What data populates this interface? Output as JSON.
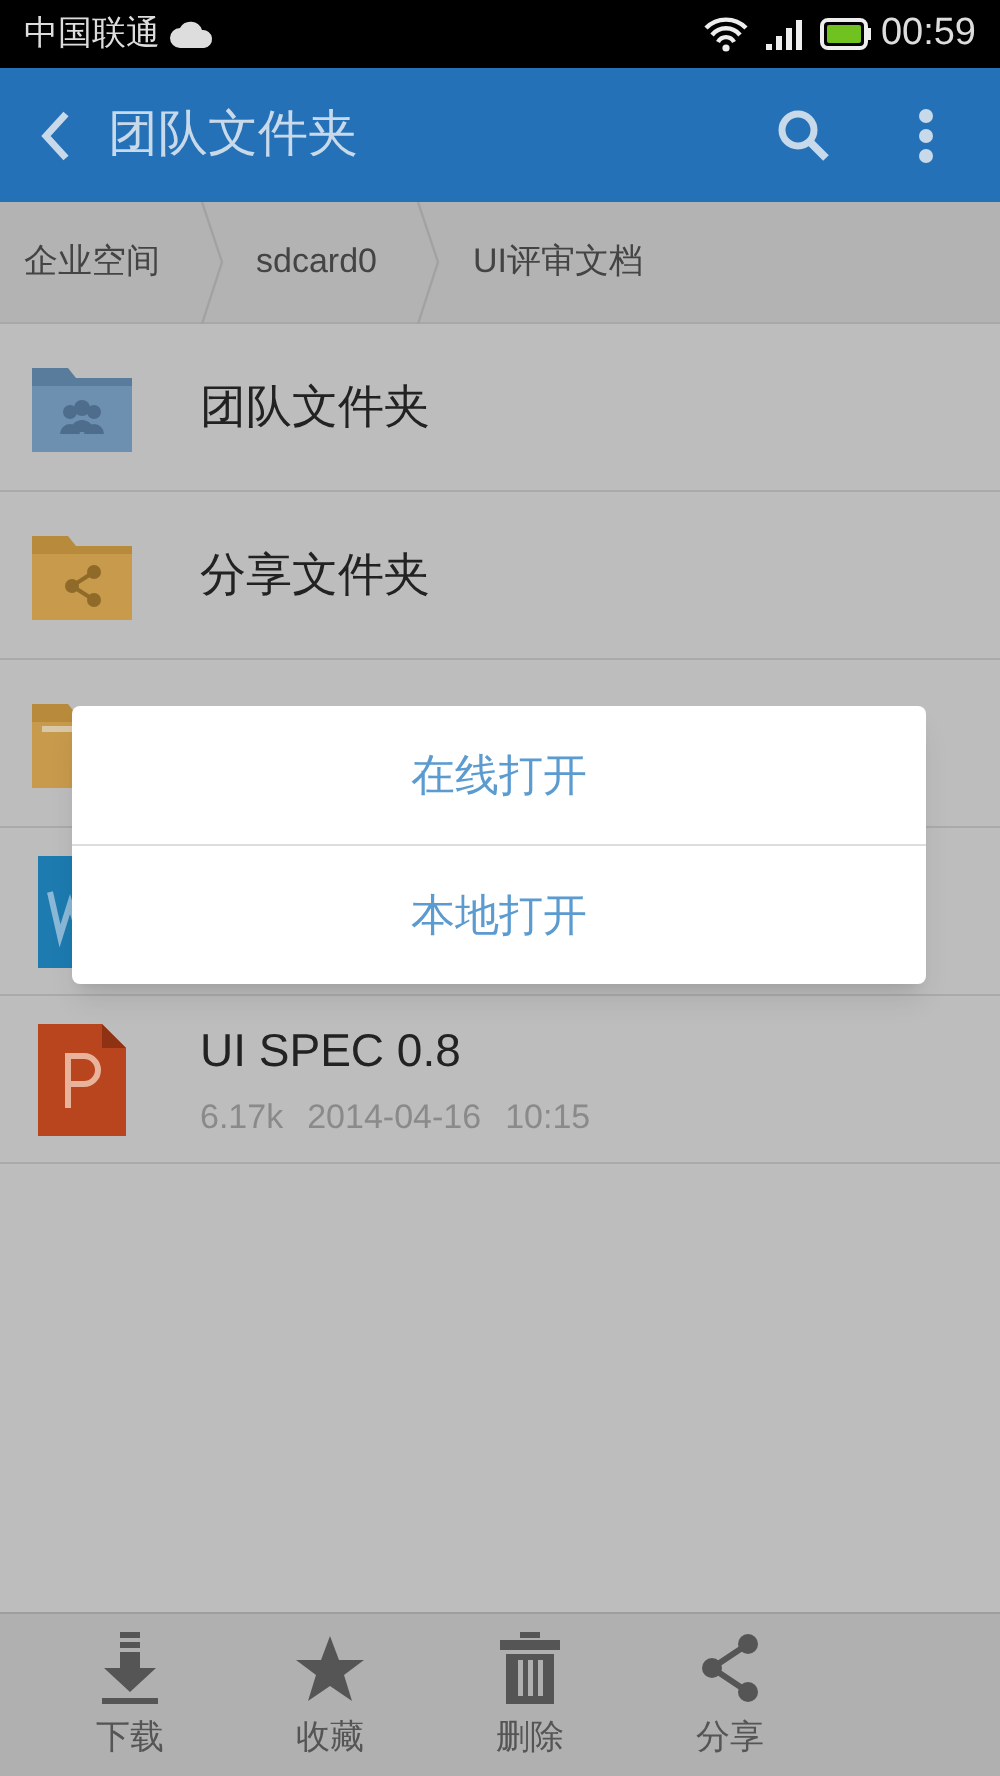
{
  "status_bar": {
    "carrier": "中国联通",
    "time": "00:59"
  },
  "app_bar": {
    "title": "团队文件夹"
  },
  "breadcrumbs": [
    "企业空间",
    "sdcard0",
    "UI评审文档"
  ],
  "files": [
    {
      "kind": "team-folder",
      "name": "团队文件夹"
    },
    {
      "kind": "share-folder",
      "name": "分享文件夹"
    },
    {
      "kind": "folder"
    },
    {
      "kind": "word"
    },
    {
      "kind": "ppt",
      "name": "UI SPEC 0.8",
      "size": "6.17k",
      "date": "2014-04-16",
      "time": "10:15"
    }
  ],
  "dialog": {
    "options": [
      "在线打开",
      "本地打开"
    ]
  },
  "toolbar": [
    {
      "kind": "download",
      "label": "下载"
    },
    {
      "kind": "star",
      "label": "收藏"
    },
    {
      "kind": "trash",
      "label": "删除"
    },
    {
      "kind": "share",
      "label": "分享"
    }
  ]
}
